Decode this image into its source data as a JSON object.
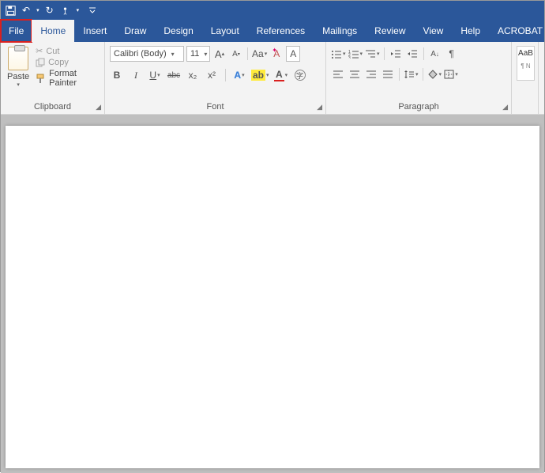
{
  "qat": {
    "save": "💾",
    "undo": "↶",
    "redo": "↻",
    "touch": "☝",
    "more": "▾"
  },
  "tabs": {
    "file": "File",
    "home": "Home",
    "insert": "Insert",
    "draw": "Draw",
    "design": "Design",
    "layout": "Layout",
    "references": "References",
    "mailings": "Mailings",
    "review": "Review",
    "view": "View",
    "help": "Help",
    "acrobat": "ACROBAT"
  },
  "clipboard": {
    "paste": "Paste",
    "cut": "Cut",
    "copy": "Copy",
    "format_painter": "Format Painter",
    "group": "Clipboard"
  },
  "font": {
    "name": "Calibri (Body)",
    "size": "11",
    "grow": "A",
    "shrink": "A",
    "case": "Aa",
    "clear": "A",
    "bold": "B",
    "italic": "I",
    "underline": "U",
    "strike": "abc",
    "sub": "x₂",
    "super": "x²",
    "effects": "A",
    "highlight": "ab",
    "color": "A",
    "charborder": "A",
    "group": "Font"
  },
  "paragraph": {
    "group": "Paragraph",
    "pilcrow": "¶"
  },
  "styles": {
    "preview": "AaB",
    "name": "¶ N"
  }
}
